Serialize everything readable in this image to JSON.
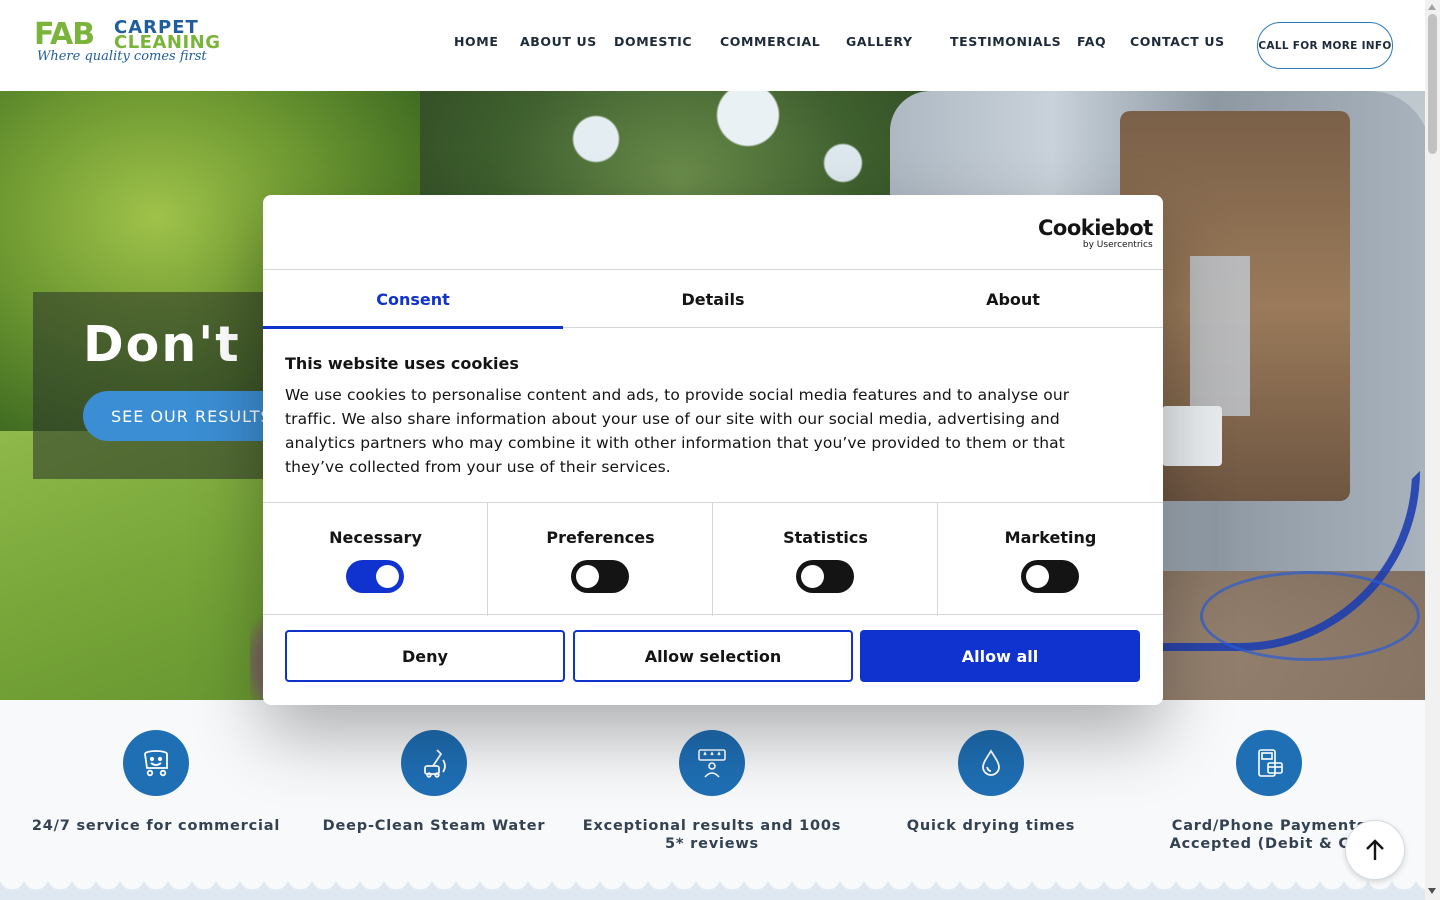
{
  "header": {
    "logo": {
      "brand_fab": "FAB",
      "brand_line1": "CARPET",
      "brand_line2": "CLEANING",
      "tagline": "Where quality comes first"
    },
    "nav": [
      {
        "label": "HOME"
      },
      {
        "label": "ABOUT US"
      },
      {
        "label": "DOMESTIC"
      },
      {
        "label": "COMMERCIAL"
      },
      {
        "label": "GALLERY"
      },
      {
        "label": "TESTIMONIALS"
      },
      {
        "label": "FAQ"
      },
      {
        "label": "CONTACT US"
      }
    ],
    "cta_label": "CALL FOR MORE INFO"
  },
  "hero": {
    "title": "Don't re",
    "button_label": "SEE OUR RESULTS"
  },
  "features": [
    {
      "label": "24/7 service for commercial",
      "icon": "happy-cart-icon"
    },
    {
      "label": "Deep-Clean Steam Water",
      "icon": "carpet-cleaner-icon"
    },
    {
      "label": "Exceptional results and 100s 5* reviews",
      "icon": "five-star-review-icon"
    },
    {
      "label": "Quick drying times",
      "icon": "water-drop-icon"
    },
    {
      "label": "Card/Phone Payments Accepted (Debit & Cre",
      "icon": "card-payment-icon"
    }
  ],
  "cookie_dialog": {
    "brand": "Cookiebot",
    "brand_sub": "by Usercentrics",
    "tabs": [
      {
        "label": "Consent",
        "active": true
      },
      {
        "label": "Details",
        "active": false
      },
      {
        "label": "About",
        "active": false
      }
    ],
    "title": "This website uses cookies",
    "body": "We use cookies to personalise content and ads, to provide social media features and to analyse our traffic. We also share information about your use of our site with our social media, advertising and analytics partners who may combine it with other information that you’ve provided to them or that they’ve collected from your use of their services.",
    "toggles": [
      {
        "label": "Necessary",
        "checked": true
      },
      {
        "label": "Preferences",
        "checked": false
      },
      {
        "label": "Statistics",
        "checked": false
      },
      {
        "label": "Marketing",
        "checked": false
      }
    ],
    "buttons": {
      "deny": "Deny",
      "allow_selection": "Allow selection",
      "allow_all": "Allow all"
    },
    "accent_color": "#1032cf"
  },
  "colors": {
    "brand_blue": "#1f6fb5",
    "brand_green": "#7bb43a",
    "hero_button": "#3b8ed3"
  }
}
